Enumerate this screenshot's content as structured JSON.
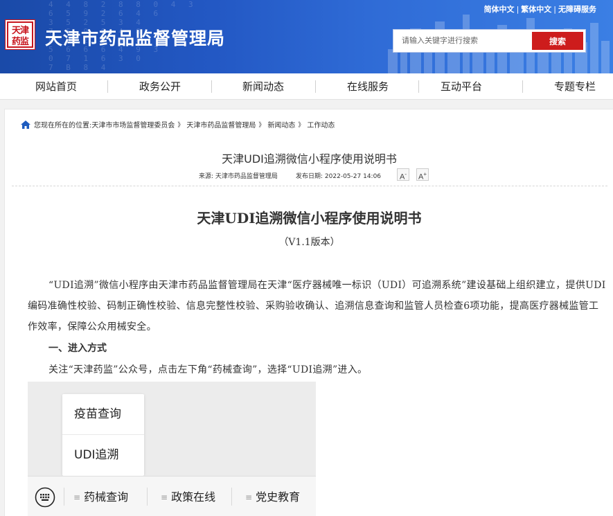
{
  "header": {
    "site_title": "天津市药品监督管理局",
    "logo_text": "天津\n药监",
    "lang_links": [
      "简体中文",
      "繁体中文",
      "无障碍服务"
    ],
    "bg_digits": "4 4 8 2 8 8 0 4 3\n6 5 9 2 6 4 6\n3 5 2 5 3 4\n7 5 9 8 4 8\n8 3 2 2 9 8\n5 6 6 6 4 9 3\n0 7 1 6 3 0\n7 B 8 4"
  },
  "search": {
    "placeholder": "请输入关键字进行搜索",
    "button_label": "搜索"
  },
  "nav": {
    "items": [
      "网站首页",
      "政务公开",
      "新闻动态",
      "在线服务",
      "互动平台",
      "专题专栏"
    ]
  },
  "breadcrumb": {
    "prefix": "您现在所在的位置:",
    "items": [
      "天津市市场监督管理委员会",
      "天津市药品监督管理局",
      "新闻动态",
      "工作动态"
    ],
    "separator": "》"
  },
  "article": {
    "title": "天津UDI追溯微信小程序使用说明书",
    "source_label": "来源:",
    "source": "天津市药品监督管理局",
    "date_label": "发布日期:",
    "date": "2022-05-27 14:06",
    "font_smaller": "A",
    "font_smaller_sup": "-",
    "font_larger": "A",
    "font_larger_sup": "+",
    "heading": "天津UDI追溯微信小程序使用说明书",
    "version": "（V1.1版本）",
    "paragraph": "“UDI追溯”微信小程序由天津市药品监督管理局在天津“医疗器械唯一标识（UDI）可追溯系统”建设基础上组织建立，提供UDI编码准确性校验、码制正确性校验、信息完整性校验、采购验收确认、追溯信息查询和监管人员检查6项功能，提高医疗器械监管工作效率，保障公众用械安全。",
    "section_title": "一、进入方式",
    "instruction": "关注“天津药监”公众号，点击左下角“药械查询”，选择“UDI追溯”进入。"
  },
  "screenshot": {
    "popup_items": [
      "疫苗查询",
      "UDI追溯"
    ],
    "tabs": [
      "药械查询",
      "政策在线",
      "党史教育"
    ],
    "tab_prefix": "≡"
  }
}
